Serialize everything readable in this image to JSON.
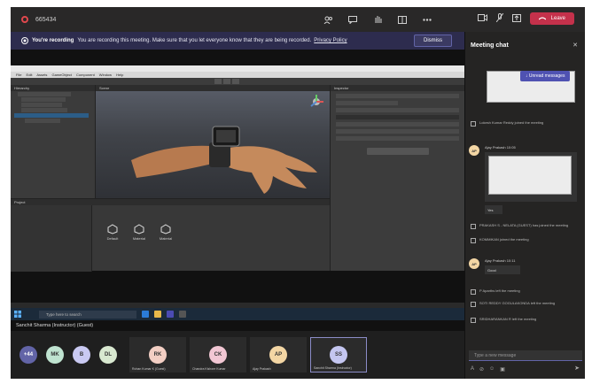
{
  "meeting": {
    "id": "665434",
    "leave_label": "Leave",
    "top_icons": [
      "participants-icon",
      "chat-icon",
      "raise-hand-icon",
      "rooms-icon",
      "more-icon"
    ],
    "top_right_icons": [
      "camera-icon",
      "mic-icon",
      "share-icon"
    ]
  },
  "banner": {
    "bold": "You're recording",
    "text": "You are recording this meeting. Make sure that you let everyone know that they are being recorded.",
    "link": "Privacy Policy",
    "dismiss_label": "Dismiss"
  },
  "unity": {
    "menu": "File Edit Assets GameObject Component Window Help",
    "hierarchy_tab": "Hierarchy",
    "scene_tab": "Scene",
    "inspector_tab": "Inspector",
    "project_tab": "Project",
    "add_component": "Add Component",
    "assets": [
      "Default",
      "Material",
      "Material"
    ],
    "presenter_label": "Sanchit Sharma (Instructor) (Guest)"
  },
  "taskbar": {
    "search_placeholder": "Type here to search"
  },
  "participants": {
    "overflow": "+44",
    "small": [
      {
        "initials": "MK",
        "color": "#bfe3d0"
      },
      {
        "initials": "B",
        "color": "#c9c9f2"
      },
      {
        "initials": "DL",
        "color": "#d8e8d0"
      }
    ],
    "tiles": [
      {
        "initials": "RK",
        "name": "Rohan Kumar K (Guest)",
        "color": "#f3cfc4"
      },
      {
        "initials": "CK",
        "name": "Chandra Kishore Kumar",
        "color": "#f2c7d4"
      },
      {
        "initials": "AP",
        "name": "Ajay Prakash",
        "color": "#f3d6a4"
      },
      {
        "initials": "SS",
        "name": "Sanchit Sharma (Instructor)",
        "color": "#c4c6f0"
      }
    ]
  },
  "chat": {
    "title": "Meeting chat",
    "unread_label": "Unread messages",
    "messages": [
      {
        "type": "system",
        "text": "Lokesh Kumar Reddy joined the meeting"
      },
      {
        "type": "user",
        "author": "Ajay Prakash",
        "time": "10:05",
        "initials": "AP",
        "extra": "Yes"
      },
      {
        "type": "system",
        "text": "PRAKASH S - NELATA (GUEST) has joined the meeting"
      },
      {
        "type": "system",
        "text": "KOMMIKAN joined the meeting"
      },
      {
        "type": "user",
        "author": "Ajay Prakash",
        "time": "10:11",
        "initials": "AP",
        "extra": "Good"
      },
      {
        "type": "system",
        "text": "P Aparths left the meeting"
      },
      {
        "type": "system",
        "text": "SOTI REDDY GOGULAKONDA left the meeting"
      },
      {
        "type": "system",
        "text": "SRIDHARANKAN R left the meeting"
      }
    ],
    "compose_placeholder": "Type a new message"
  }
}
